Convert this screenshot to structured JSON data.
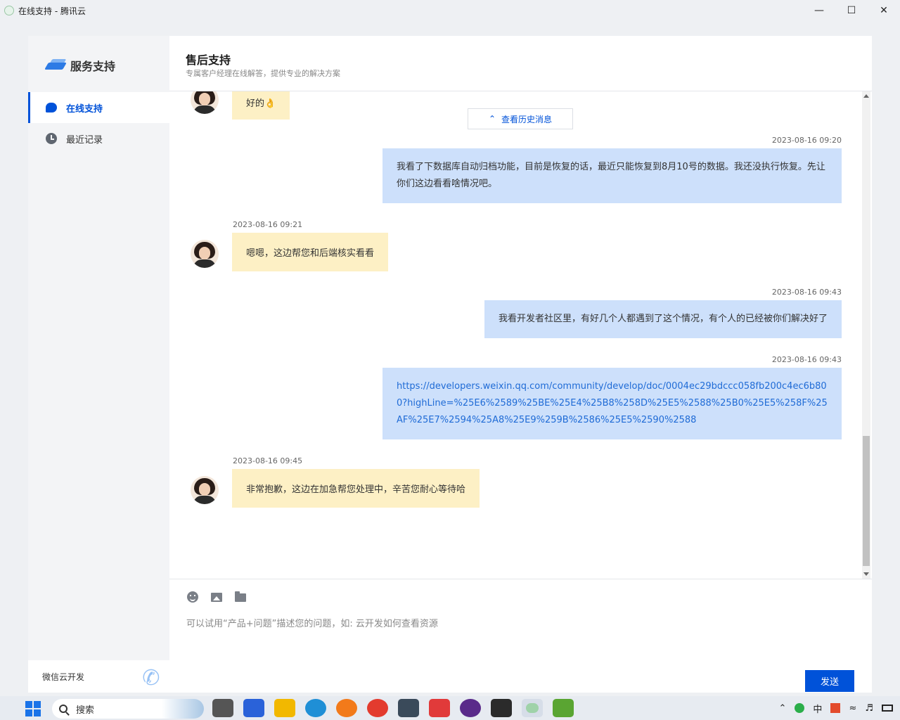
{
  "window": {
    "title": "在线支持 - 腾讯云",
    "controls": [
      "minimize-icon",
      "maximize-icon",
      "close-icon"
    ]
  },
  "sidebar": {
    "brand": "服务支持",
    "items": [
      {
        "label": "在线支持",
        "icon": "chat-bubble-icon",
        "active": true
      },
      {
        "label": "最近记录",
        "icon": "clock-icon",
        "active": false
      }
    ],
    "promo": "微信云开发"
  },
  "header": {
    "title": "售后支持",
    "subtitle": "专属客户经理在线解答，提供专业的解决方案"
  },
  "chat": {
    "history_button": "查看历史消息",
    "messages": [
      {
        "from": "agent",
        "time": "",
        "text": "好的👌"
      },
      {
        "from": "user",
        "time": "2023-08-16 09:20",
        "text": "我看了下数据库自动归档功能，目前是恢复的话，最近只能恢复到8月10号的数据。我还没执行恢复。先让你们这边看看啥情况吧。"
      },
      {
        "from": "agent",
        "time": "2023-08-16 09:21",
        "text": "嗯嗯，这边帮您和后端核实看看"
      },
      {
        "from": "user",
        "time": "2023-08-16 09:43",
        "text": "我看开发者社区里，有好几个人都遇到了这个情况，有个人的已经被你们解决好了"
      },
      {
        "from": "user",
        "time": "2023-08-16 09:43",
        "text": "https://developers.weixin.qq.com/community/develop/doc/0004ec29bdccc058fb200c4ec6b800?highLine=%25E6%2589%25BE%25E4%25B8%258D%25E5%2588%25B0%25E5%258F%25AF%25E7%2594%25A8%25E9%259B%2586%25E5%2590%2588"
      },
      {
        "from": "agent",
        "time": "2023-08-16 09:45",
        "text": "非常抱歉，这边在加急帮您处理中，辛苦您耐心等待哈"
      }
    ]
  },
  "composer": {
    "tools": [
      "emoji-icon",
      "image-icon",
      "folder-icon"
    ],
    "placeholder": "可以试用“产品+问题”描述您的问题，如: 云开发如何查看资源",
    "send_label": "发送"
  },
  "taskbar": {
    "search_label": "搜索",
    "tray_ime": "中",
    "apps": [
      "task-view",
      "app-blue",
      "file-explorer",
      "edge",
      "app-orange",
      "chrome",
      "app-terminal-like",
      "wps",
      "app-purple",
      "terminal",
      "wechat",
      "app-green"
    ]
  },
  "colors": {
    "accent": "#0052d9",
    "agent_bubble": "#fdf0c5",
    "user_bubble": "#cde0fb",
    "link": "#1f6bd6"
  }
}
